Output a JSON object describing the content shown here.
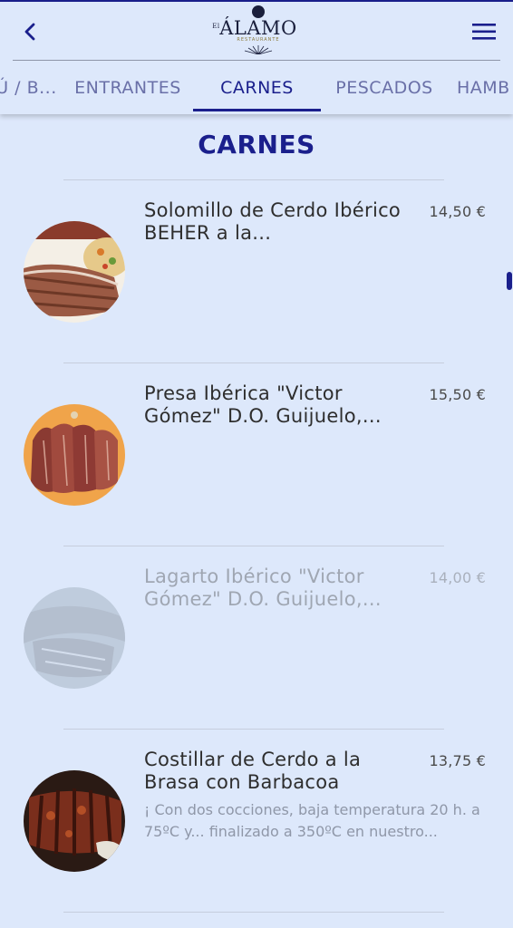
{
  "header": {
    "logo_text": "ÁLAMO",
    "logo_prefix": "El",
    "logo_sub": "RESTAURANTE"
  },
  "tabs": [
    {
      "label": "Ú / B..."
    },
    {
      "label": "ENTRANTES"
    },
    {
      "label": "CARNES",
      "active": true
    },
    {
      "label": "PESCADOS"
    },
    {
      "label": "HAMB"
    }
  ],
  "section": {
    "title": "CARNES"
  },
  "items": [
    {
      "name": "Solomillo de Cerdo Ibérico BEHER a la...",
      "price": "14,50 €",
      "description": "",
      "available": true
    },
    {
      "name": "Presa Ibérica \"Victor Gómez\" D.O. Guijuelo,...",
      "price": "15,50 €",
      "description": "",
      "available": true
    },
    {
      "name": "Lagarto Ibérico \"Victor Gómez\" D.O. Guijuelo,...",
      "price": "14,00 €",
      "description": "",
      "available": false
    },
    {
      "name": "Costillar de Cerdo a la Brasa con Barbacoa",
      "price": "13,75 €",
      "description": "¡ Con dos cocciones, baja temperatura 20 h. a 75ºC y... finalizado a 350ºC en nuestro...",
      "available": true
    }
  ],
  "colors": {
    "accent": "#1a1f8c",
    "background": "#dde8fb"
  },
  "icons": {
    "back": "chevron-left-icon",
    "menu": "hamburger-menu-icon"
  }
}
